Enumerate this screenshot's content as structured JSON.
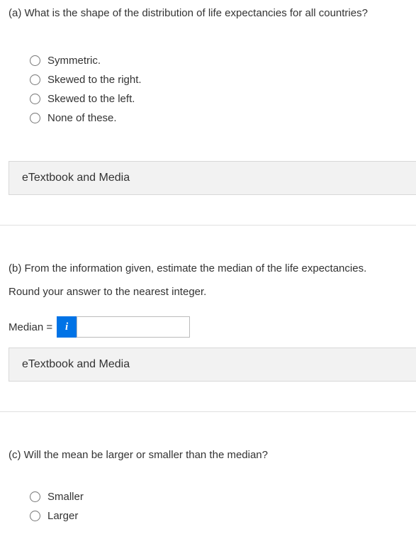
{
  "part_a": {
    "prompt": "(a) What is the shape of the distribution of life expectancies for all countries?",
    "options": [
      "Symmetric.",
      "Skewed to the right.",
      "Skewed to the left.",
      "None of these."
    ]
  },
  "part_b": {
    "prompt": "(b) From the information given, estimate the median of the life expectancies.",
    "instruction": "Round your answer to the nearest integer.",
    "input_label": "Median =",
    "info_icon": "i",
    "input_value": ""
  },
  "part_c": {
    "prompt": "(c) Will the mean be larger or smaller than the median?",
    "options": [
      "Smaller",
      "Larger"
    ]
  },
  "etextbook_label": "eTextbook and Media"
}
